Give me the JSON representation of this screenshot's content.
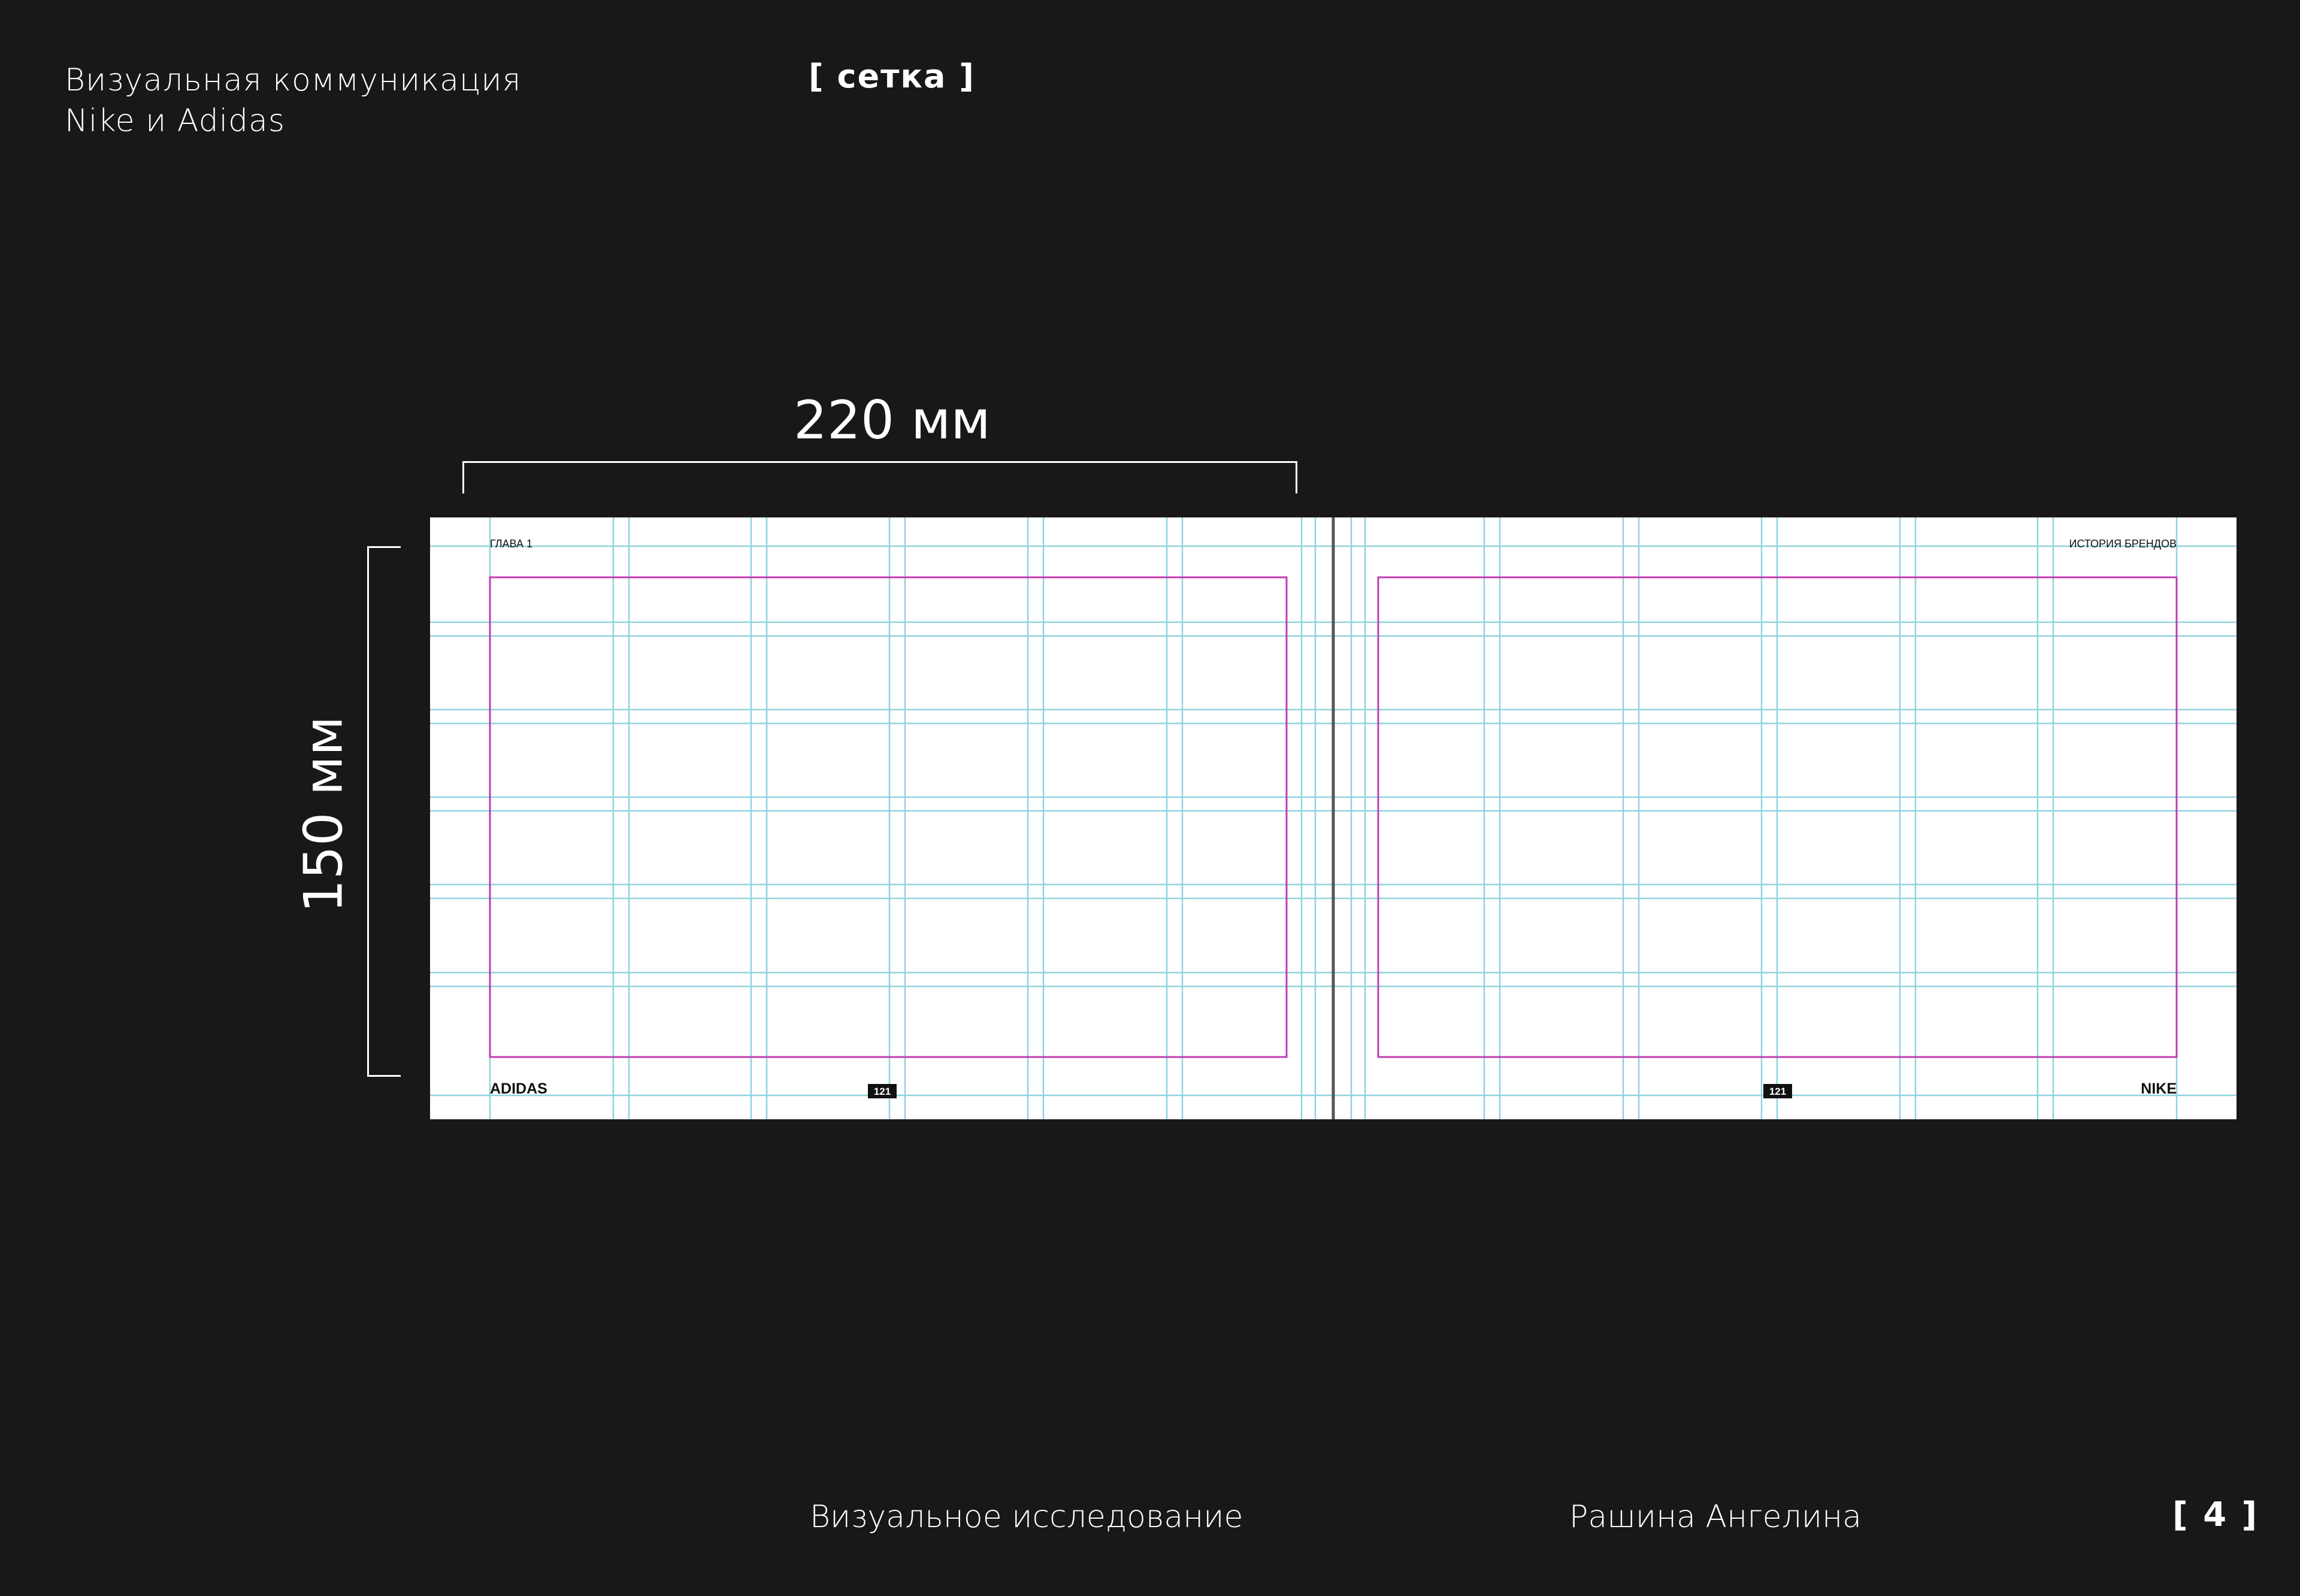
{
  "header": {
    "title_line1": "Визуальная коммуникация",
    "title_line2": "Nike и Adidas",
    "section": "[ сетка ]"
  },
  "dimensions": {
    "width": "220 мм",
    "height": "150 мм"
  },
  "spread": {
    "left_page": {
      "running_head": "ГЛАВА 1",
      "footer_brand": "ADIDAS",
      "page_number": "121"
    },
    "right_page": {
      "running_head": "ИСТОРИЯ БРЕНДОВ",
      "footer_brand": "NIKE",
      "page_number": "121"
    }
  },
  "footer": {
    "subject": "Визуальное исследование",
    "author": "Рашина Ангелина",
    "page": "[ 4 ]"
  },
  "colors": {
    "background": "#181818",
    "text": "#ffffff",
    "page": "#ffffff",
    "guide": "#8fd3df",
    "margin_frame": "#c23cb3",
    "spine": "#555555"
  }
}
